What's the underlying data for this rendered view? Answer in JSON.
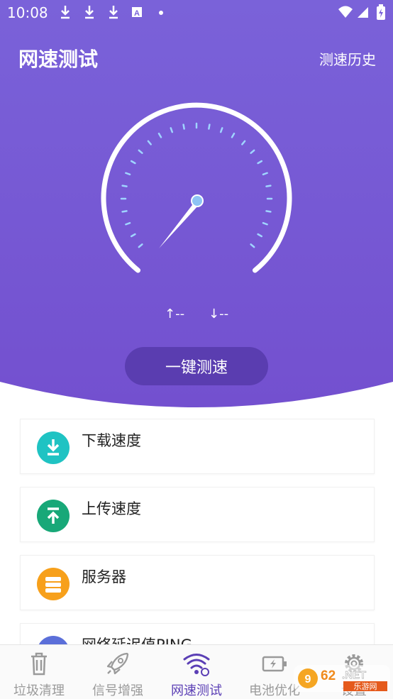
{
  "status_bar": {
    "time": "10:08"
  },
  "header": {
    "title": "网速测试",
    "history_link": "测速历史"
  },
  "gauge": {
    "upload_rate": "↑--",
    "download_rate": "↓--"
  },
  "main_button": "一键测速",
  "cards": [
    {
      "label": "下载速度",
      "icon": "download-icon",
      "color": "#1fc3c3"
    },
    {
      "label": "上传速度",
      "icon": "upload-icon",
      "color": "#18a878"
    },
    {
      "label": "服务器",
      "icon": "server-icon",
      "color": "#f7a01b"
    },
    {
      "label": "网络延迟值PING",
      "icon": "ping-icon",
      "color": "#5b6fd9"
    }
  ],
  "bottom_nav": [
    {
      "label": "垃圾清理",
      "icon": "trash-icon"
    },
    {
      "label": "信号增强",
      "icon": "rocket-icon"
    },
    {
      "label": "网速测试",
      "icon": "wifi-speed-icon",
      "active": true
    },
    {
      "label": "电池优化",
      "icon": "battery-icon"
    },
    {
      "label": "设置",
      "icon": "gear-icon"
    }
  ],
  "watermark": "962.NET 乐游网",
  "colors": {
    "hero_top": "#7a62d9",
    "hero_bottom": "#7552cf",
    "button": "#5a3db0",
    "active_tab": "#5b3fb5"
  }
}
